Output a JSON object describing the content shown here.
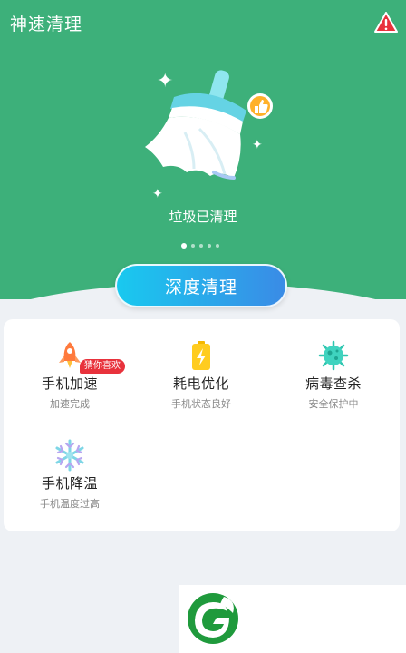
{
  "header": {
    "title": "神速清理",
    "warning_icon": "warning-icon"
  },
  "hero": {
    "illustration": "broom-icon",
    "status_text": "垃圾已清理",
    "pager": {
      "count": 5,
      "active_index": 0
    },
    "deep_clean_label": "深度清理"
  },
  "colors": {
    "hero_bg": "#3db07a",
    "button_gradient_start": "#19c9ef",
    "button_gradient_end": "#3a8be6",
    "badge_red": "#e8323c",
    "warning_red": "#e8323c"
  },
  "features": [
    {
      "name": "手机加速",
      "status": "加速完成",
      "icon": "rocket-icon",
      "badge": "猜你喜欢"
    },
    {
      "name": "耗电优化",
      "status": "手机状态良好",
      "icon": "battery-icon"
    },
    {
      "name": "病毒查杀",
      "status": "安全保护中",
      "icon": "virus-icon"
    },
    {
      "name": "手机降温",
      "status": "手机温度过高",
      "icon": "snowflake-icon"
    }
  ],
  "ad": {
    "logo_icon": "leaf-logo-icon"
  }
}
